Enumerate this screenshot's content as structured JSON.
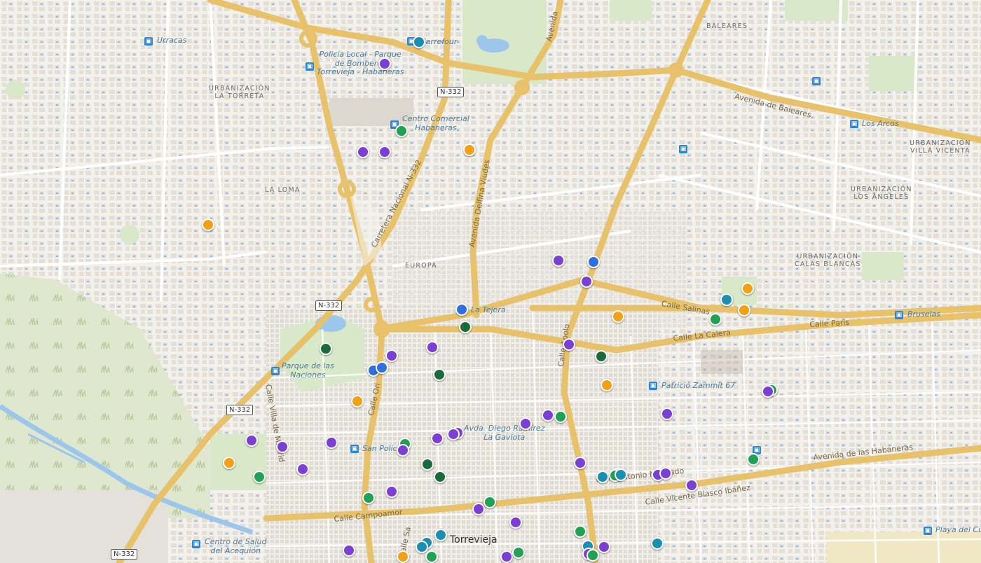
{
  "colors": {
    "background": "#f3f1ec",
    "road_major": "#f5d98b",
    "road_minor": "#ffffff",
    "park": "#d8e8c8",
    "water": "#9dc6ec",
    "building": "#e2ded6",
    "marker_purple": "#7b3fd6",
    "marker_green": "#21a153",
    "marker_darkgreen": "#1b6b3a",
    "marker_orange": "#f2a016",
    "marker_teal": "#1b8fb2",
    "marker_blue": "#2f6fe0"
  },
  "place_labels": {
    "urbanizacion_la_torreta": "URBANIZACIÓN\nLA TORRETA",
    "la_loma": "LA LOMA",
    "europa": "EUROPA",
    "baleares": "BALEARES",
    "urbanizacion_villa_vicenta": "URBANIZACIÓN\nVILLA VICENTA",
    "urbanizacion_los_angeles": "URBANIZACIÓN\nLOS ÁNGELES",
    "urbanizacion_calas_blancas": "URBANIZACIÓN\nCALAS BLANCAS",
    "torrevieja": "Torrevieja"
  },
  "street_labels": {
    "avenida_de_baleares": "Avenida de Baleares",
    "carretera_nacional": "Carretera Nacional N-332",
    "avenida_delfina_viudes": "Avenida Delfina Viudes",
    "avenida_top": "Avenida",
    "calle_salinas": "Calle Salinas",
    "calle_la_calera": "Calle La Calera",
    "calle_paris": "Calle Paris",
    "calle_apolo": "Calle Apolo",
    "calle_orihuela": "Calle Ori",
    "calle_villa_madrid": "Calle Villa de Madrid",
    "avenida_habaneras": "Avenida de las Habaneras",
    "calle_vicente_blasco": "Calle Vicente Blasco Ibáñez",
    "calle_antonio_machado": "Calle Antonio Machado",
    "calle_campoamor": "Calle Campoamor",
    "calle_sa": "Calle Sa"
  },
  "poi_labels": {
    "urracas": "Urracas",
    "carrefour": "Carrefour",
    "policia_local": "Policía Local - Parque\nde Bomberos\nTorrevieja - Habaneras",
    "centro_comercial": "Centro Comercial\nHabaneras",
    "los_arcos": "Los Arcos",
    "la_tejera": "La Tejera",
    "bruselas": "Bruselas",
    "parque_naciones": "Parque de las\nNaciones",
    "patricio_zammit": "Patricio Zammit 67",
    "diego_ramirez": "Avda. Diego Ramírez\nLa Gaviota",
    "san_policarpo": "San Polic",
    "centro_salud": "Centro de Salud\ndel Acequión",
    "playa_del_cura": "Playa del Cu"
  },
  "road_shields": [
    "N-332",
    "N-332",
    "N-332",
    "N-332"
  ],
  "icons": {
    "bus_stop": "bus-stop-icon",
    "map_marker": "map-marker-icon"
  },
  "markers": [
    {
      "c": "purple",
      "n": "marker-1"
    },
    {
      "c": "teal",
      "n": "marker-2"
    },
    {
      "c": "green",
      "n": "marker-3"
    },
    {
      "c": "purple",
      "n": "marker-4"
    },
    {
      "c": "purple",
      "n": "marker-5"
    },
    {
      "c": "orange",
      "n": "marker-6"
    },
    {
      "c": "orange",
      "n": "marker-7"
    },
    {
      "c": "purple",
      "n": "marker-8"
    },
    {
      "c": "blue",
      "n": "marker-9"
    },
    {
      "c": "purple",
      "n": "marker-10"
    },
    {
      "c": "orange",
      "n": "marker-11"
    },
    {
      "c": "teal",
      "n": "marker-12"
    },
    {
      "c": "orange",
      "n": "marker-13"
    },
    {
      "c": "green",
      "n": "marker-14"
    },
    {
      "c": "blue",
      "n": "marker-15"
    },
    {
      "c": "darkgreen",
      "n": "marker-16"
    },
    {
      "c": "orange",
      "n": "marker-17"
    },
    {
      "c": "purple",
      "n": "marker-18"
    },
    {
      "c": "darkgreen",
      "n": "marker-19"
    },
    {
      "c": "darkgreen",
      "n": "marker-20"
    },
    {
      "c": "purple",
      "n": "marker-21"
    },
    {
      "c": "purple",
      "n": "marker-22"
    },
    {
      "c": "blue",
      "n": "marker-23"
    },
    {
      "c": "blue",
      "n": "marker-24"
    },
    {
      "c": "darkgreen",
      "n": "marker-25"
    },
    {
      "c": "orange",
      "n": "marker-26"
    },
    {
      "c": "orange",
      "n": "marker-27"
    },
    {
      "c": "green",
      "n": "marker-28"
    },
    {
      "c": "purple",
      "n": "marker-29"
    },
    {
      "c": "purple",
      "n": "marker-30"
    },
    {
      "c": "purple",
      "n": "marker-31"
    },
    {
      "c": "green",
      "n": "marker-32"
    },
    {
      "c": "purple",
      "n": "marker-33"
    },
    {
      "c": "purple",
      "n": "marker-34"
    },
    {
      "c": "purple",
      "n": "marker-35"
    },
    {
      "c": "purple",
      "n": "marker-36"
    },
    {
      "c": "purple",
      "n": "marker-37"
    },
    {
      "c": "purple",
      "n": "marker-38"
    },
    {
      "c": "green",
      "n": "marker-39"
    },
    {
      "c": "purple",
      "n": "marker-40"
    },
    {
      "c": "purple",
      "n": "marker-41"
    },
    {
      "c": "orange",
      "n": "marker-42"
    },
    {
      "c": "green",
      "n": "marker-43"
    },
    {
      "c": "purple",
      "n": "marker-44"
    },
    {
      "c": "darkgreen",
      "n": "marker-45"
    },
    {
      "c": "darkgreen",
      "n": "marker-46"
    },
    {
      "c": "purple",
      "n": "marker-47"
    },
    {
      "c": "green",
      "n": "marker-48"
    },
    {
      "c": "green",
      "n": "marker-49"
    },
    {
      "c": "purple",
      "n": "marker-50"
    },
    {
      "c": "purple",
      "n": "marker-51"
    },
    {
      "c": "purple",
      "n": "marker-52"
    },
    {
      "c": "teal",
      "n": "marker-53"
    },
    {
      "c": "green",
      "n": "marker-54"
    },
    {
      "c": "teal",
      "n": "marker-55"
    },
    {
      "c": "purple",
      "n": "marker-56"
    },
    {
      "c": "purple",
      "n": "marker-57"
    },
    {
      "c": "purple",
      "n": "marker-58"
    },
    {
      "c": "green",
      "n": "marker-59"
    },
    {
      "c": "purple",
      "n": "marker-60"
    },
    {
      "c": "green",
      "n": "marker-61"
    },
    {
      "c": "teal",
      "n": "marker-62"
    },
    {
      "c": "teal",
      "n": "marker-63"
    },
    {
      "c": "teal",
      "n": "marker-64"
    },
    {
      "c": "green",
      "n": "marker-65"
    },
    {
      "c": "green",
      "n": "marker-66"
    },
    {
      "c": "teal",
      "n": "marker-67"
    },
    {
      "c": "purple",
      "n": "marker-68"
    },
    {
      "c": "teal",
      "n": "marker-69"
    },
    {
      "c": "green",
      "n": "marker-70"
    },
    {
      "c": "purple",
      "n": "marker-71"
    },
    {
      "c": "orange",
      "n": "marker-72"
    },
    {
      "c": "purple",
      "n": "marker-73"
    },
    {
      "c": "green",
      "n": "marker-74"
    }
  ]
}
